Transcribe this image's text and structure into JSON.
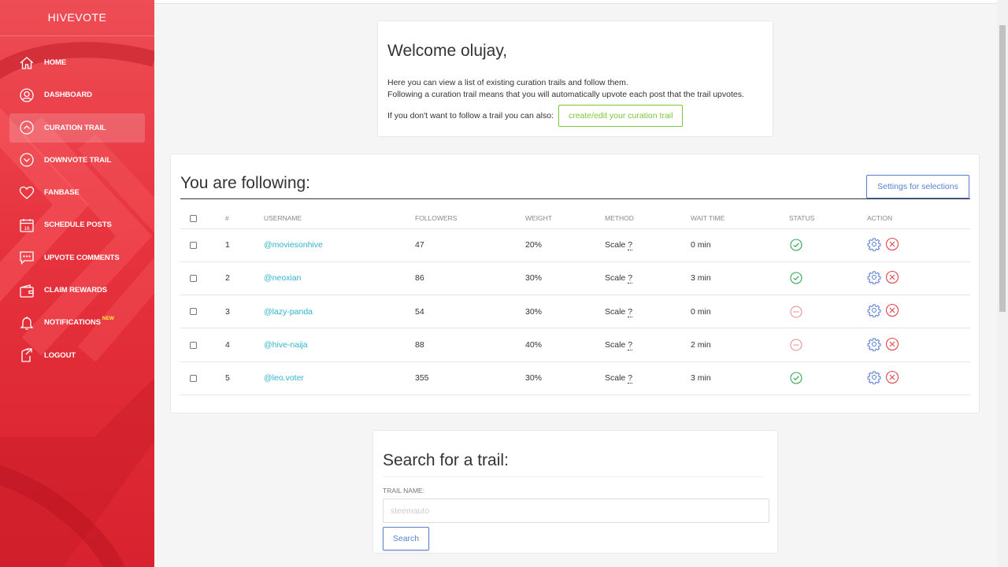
{
  "sidebar": {
    "brand": "HIVEVOTE",
    "items": [
      {
        "label": "HOME",
        "icon": "home-icon"
      },
      {
        "label": "DASHBOARD",
        "icon": "user-icon"
      },
      {
        "label": "CURATION TRAIL",
        "icon": "chevron-up-circle-icon",
        "active": true
      },
      {
        "label": "DOWNVOTE TRAIL",
        "icon": "chevron-down-circle-icon"
      },
      {
        "label": "FANBASE",
        "icon": "heart-icon"
      },
      {
        "label": "SCHEDULE POSTS",
        "icon": "calendar-icon",
        "calendar_day": "16"
      },
      {
        "label": "UPVOTE COMMENTS",
        "icon": "comment-icon"
      },
      {
        "label": "CLAIM REWARDS",
        "icon": "wallet-icon"
      },
      {
        "label": "NOTIFICATIONS",
        "icon": "bell-icon",
        "badge": "NEW"
      },
      {
        "label": "LOGOUT",
        "icon": "logout-icon"
      }
    ]
  },
  "welcome": {
    "title": "Welcome olujay,",
    "line1": "Here you can view a list of existing curation trails and follow them.",
    "line2": "Following a curation trail means that you will automatically upvote each post that the trail upvotes.",
    "line3": "If you don't want to follow a trail you can also:",
    "button": "create/edit your curation trail"
  },
  "following": {
    "title": "You are following:",
    "settings_button": "Settings for selections",
    "columns": [
      "#",
      "USERNAME",
      "FOLLOWERS",
      "WEIGHT",
      "METHOD",
      "WAIT TIME",
      "STATUS",
      "ACTION"
    ],
    "rows": [
      {
        "num": "1",
        "username": "@moviesonhive",
        "followers": "47",
        "weight": "20%",
        "method": "Scale",
        "wait": "0 min",
        "status": "active"
      },
      {
        "num": "2",
        "username": "@neoxian",
        "followers": "86",
        "weight": "30%",
        "method": "Scale",
        "wait": "3 min",
        "status": "active"
      },
      {
        "num": "3",
        "username": "@lazy-panda",
        "followers": "54",
        "weight": "30%",
        "method": "Scale",
        "wait": "0 min",
        "status": "paused"
      },
      {
        "num": "4",
        "username": "@hive-naija",
        "followers": "88",
        "weight": "40%",
        "method": "Scale",
        "wait": "2 min",
        "status": "paused"
      },
      {
        "num": "5",
        "username": "@leo.voter",
        "followers": "355",
        "weight": "30%",
        "method": "Scale",
        "wait": "3 min",
        "status": "active"
      }
    ]
  },
  "search": {
    "title": "Search for a trail:",
    "label": "TRAIL NAME:",
    "placeholder": "steemauto",
    "button": "Search"
  },
  "colors": {
    "sidebar": "#e6323d",
    "link": "#30b3cf",
    "primary": "#5b7fd6",
    "success": "#3aa655",
    "danger": "#e2454d",
    "create_button": "#7cc53c"
  }
}
